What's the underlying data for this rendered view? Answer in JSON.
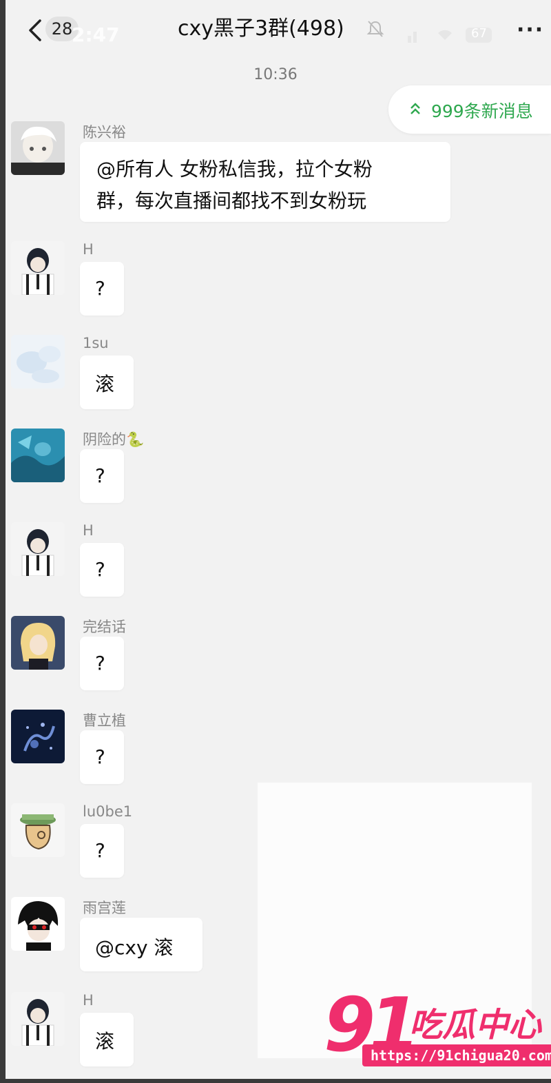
{
  "header": {
    "back_badge": "28",
    "ghost_time": "2:47",
    "title": "cxy黑子3群(498)",
    "battery": "67",
    "more": "···"
  },
  "timestamp": "10:36",
  "new_messages": "999条新消息",
  "messages": [
    {
      "name": "陈兴裕",
      "text_line1": "@所有人  女粉私信我，拉个女粉",
      "text_line2": "群，每次直播间都找不到女粉玩"
    },
    {
      "name": "H",
      "text": "?"
    },
    {
      "name": "1su",
      "text": "滚"
    },
    {
      "name": "阴险的🐍",
      "text": "?"
    },
    {
      "name": "H",
      "text": "?"
    },
    {
      "name": "完结话",
      "text": "?"
    },
    {
      "name": "曹立植",
      "text": "?"
    },
    {
      "name": "lu0be1",
      "text": "?"
    },
    {
      "name": "雨宫莲",
      "text": "@cxy  滚"
    },
    {
      "name": "H",
      "text": "滚"
    }
  ],
  "watermark": {
    "number": "91",
    "brand": "吃瓜中心",
    "url": "https://91chigua20.com"
  },
  "colors": {
    "accent_green": "#2fa84f",
    "watermark_pink": "#ef2e6d"
  }
}
